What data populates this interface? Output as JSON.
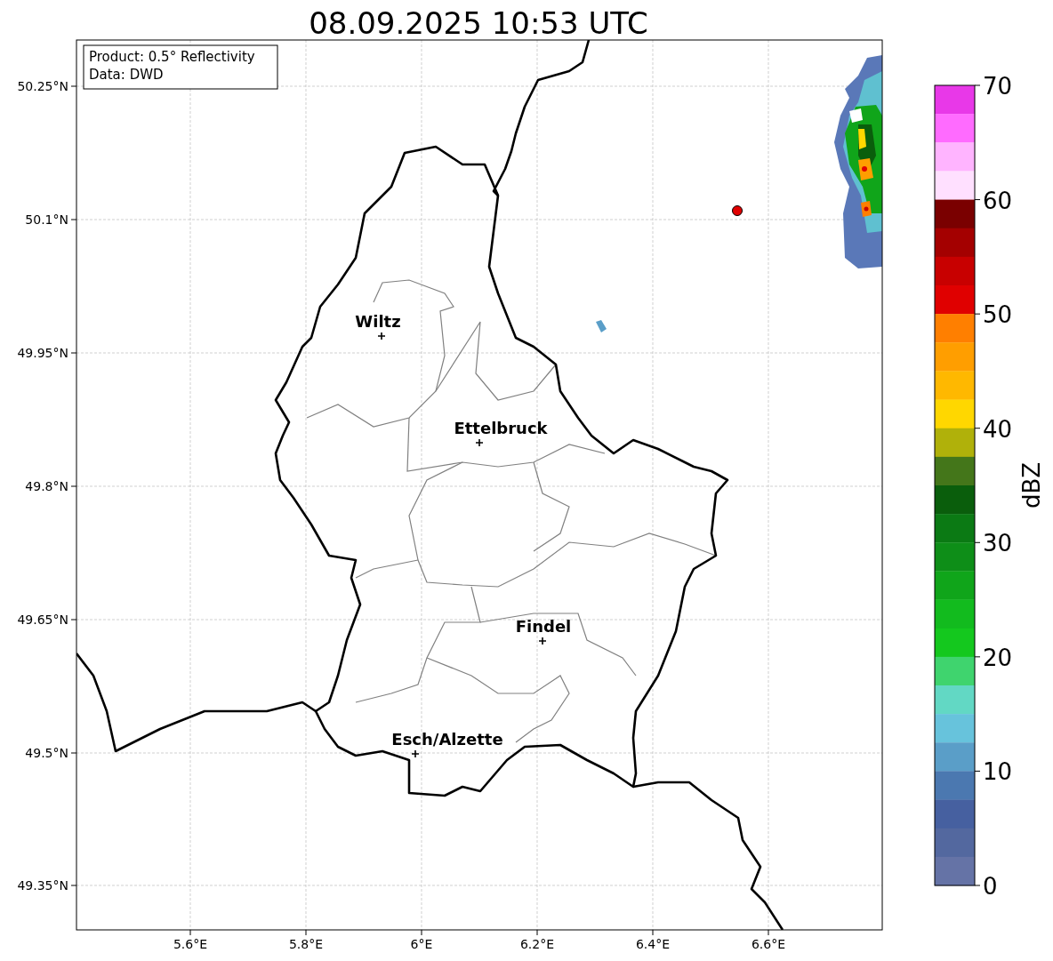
{
  "title": "08.09.2025 10:53 UTC",
  "info_box": {
    "lines": [
      "Product: 0.5° Reflectivity",
      "Data: DWD"
    ]
  },
  "lat_ticks": [
    "50.25°N",
    "50.1°N",
    "49.95°N",
    "49.8°N",
    "49.65°N",
    "49.5°N",
    "49.35°N"
  ],
  "lon_ticks": [
    "5.6°E",
    "5.8°E",
    "6°E",
    "6.2°E",
    "6.4°E",
    "6.6°E"
  ],
  "cities": [
    {
      "name": "Wiltz"
    },
    {
      "name": "Ettelbruck"
    },
    {
      "name": "Findel"
    },
    {
      "name": "Esch/Alzette"
    }
  ],
  "colorbar": {
    "label": "dBZ",
    "ticks": [
      "70",
      "60",
      "50",
      "40",
      "30",
      "20",
      "10",
      "0"
    ],
    "segments": [
      {
        "color": "#e838e8"
      },
      {
        "color": "#ff6bff"
      },
      {
        "color": "#ffb4ff"
      },
      {
        "color": "#ffe0ff"
      },
      {
        "color": "#7a0000"
      },
      {
        "color": "#a40000"
      },
      {
        "color": "#c80000"
      },
      {
        "color": "#e00000"
      },
      {
        "color": "#ff7f00"
      },
      {
        "color": "#ff9e00"
      },
      {
        "color": "#ffb800"
      },
      {
        "color": "#ffd700"
      },
      {
        "color": "#b0b10a"
      },
      {
        "color": "#44761a"
      },
      {
        "color": "#0a5e0c"
      },
      {
        "color": "#0b7a14"
      },
      {
        "color": "#0e8e18"
      },
      {
        "color": "#10a51a"
      },
      {
        "color": "#12bb1e"
      },
      {
        "color": "#14c81e"
      },
      {
        "color": "#3fd46e"
      },
      {
        "color": "#62d8c4"
      },
      {
        "color": "#67c3dc"
      },
      {
        "color": "#5a9ec8"
      },
      {
        "color": "#4b78b0"
      },
      {
        "color": "#4660a0"
      },
      {
        "color": "#53689f"
      },
      {
        "color": "#6573a6"
      }
    ]
  }
}
